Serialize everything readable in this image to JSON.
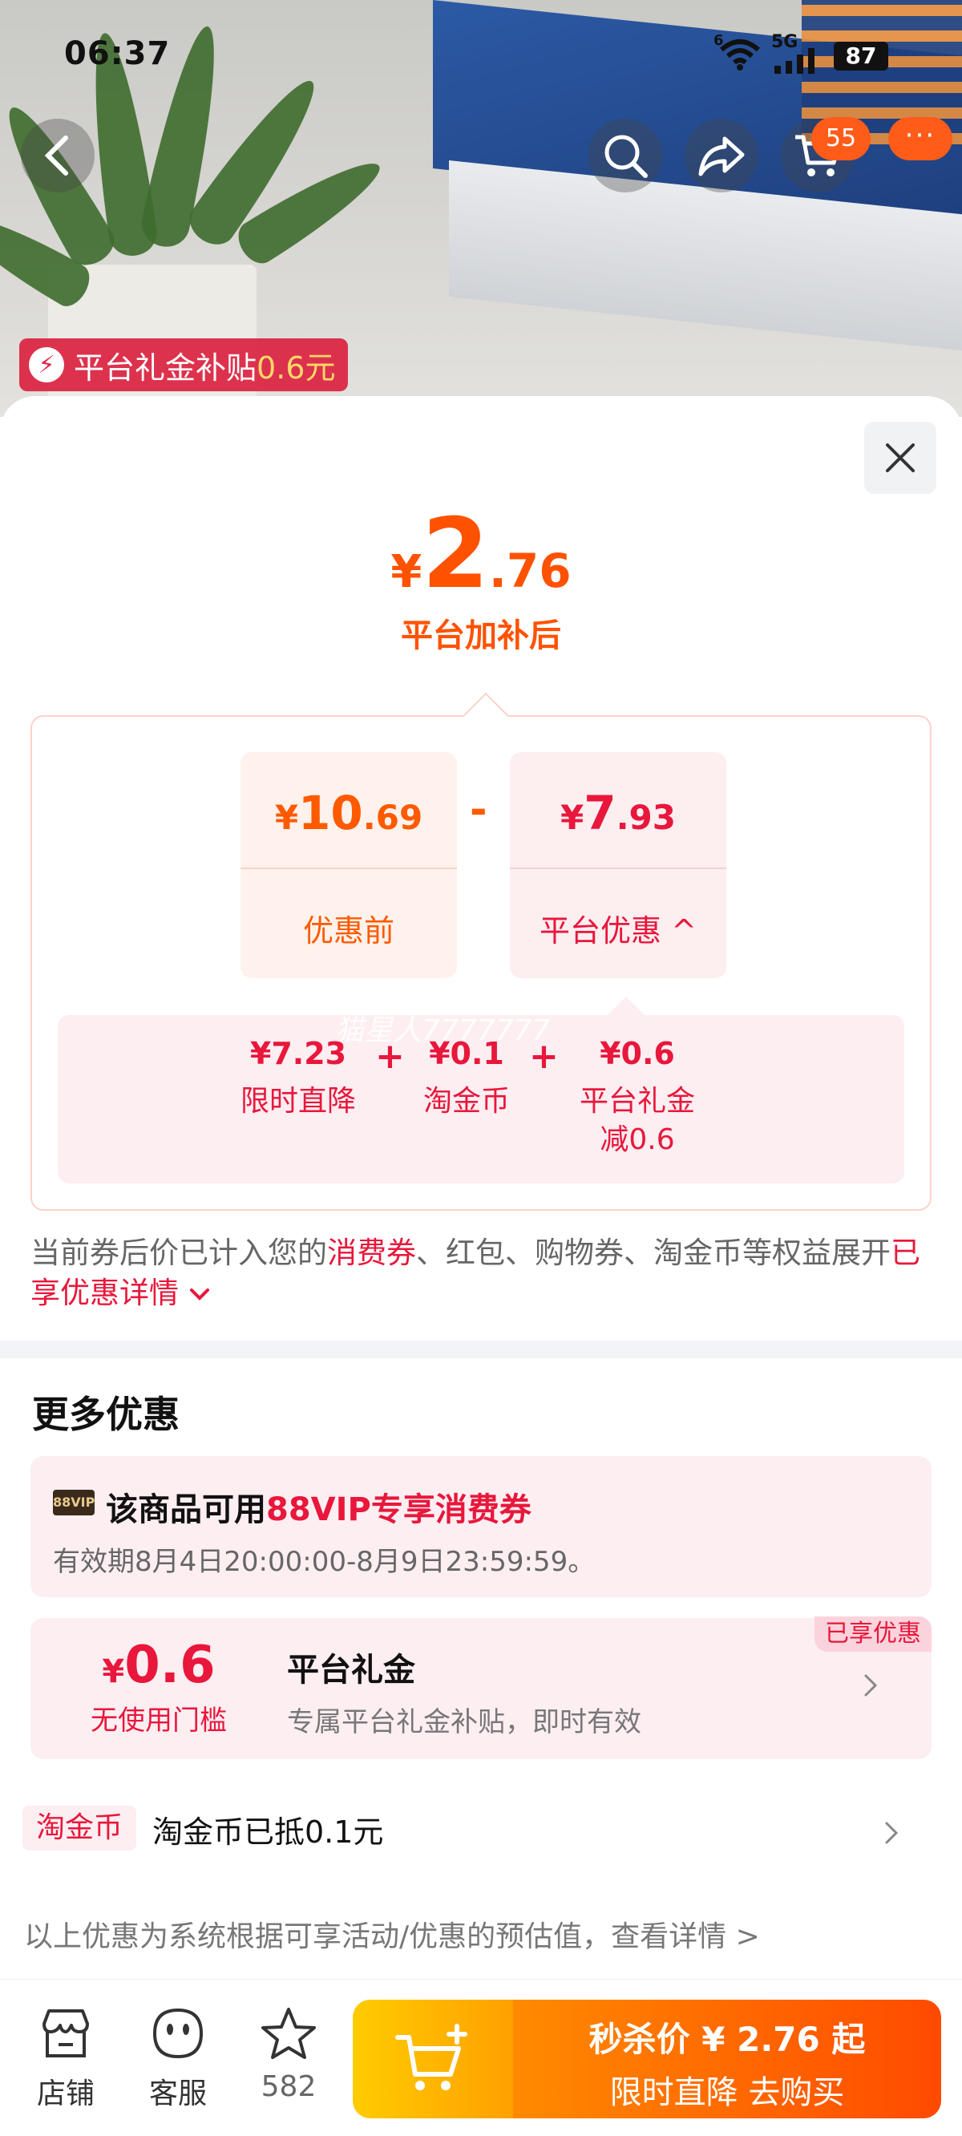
{
  "status_bar": {
    "time": "06:37",
    "wifi_label": "6",
    "network": "5G",
    "battery": "87"
  },
  "nav": {
    "cart_count": "55",
    "more_label": "···"
  },
  "subsidy_tag": {
    "label": "平台礼金补贴",
    "amount": "0.6元"
  },
  "final_price": {
    "currency": "¥",
    "integer": "2",
    "decimal": ".76",
    "caption": "平台加补后"
  },
  "calc": {
    "before": {
      "currency": "¥",
      "integer": "10",
      "decimal": ".69",
      "label": "优惠前"
    },
    "operator": "-",
    "discount": {
      "currency": "¥",
      "integer": "7",
      "decimal": ".93",
      "label": "平台优惠",
      "chevron": "^"
    }
  },
  "breakdown": {
    "items": [
      {
        "value": "¥7.23",
        "label": "限时直降"
      },
      {
        "value": "¥0.1",
        "label": "淘金币"
      },
      {
        "value": "¥0.6",
        "label": "平台礼金",
        "label2": "减0.6"
      }
    ],
    "plus": "+",
    "watermark": "猫星人7777777"
  },
  "note": {
    "prefix": "当前券后价已计入您的",
    "highlight": "消费券",
    "middle": "、红包、购物券、淘金币等权益展开",
    "link": "已享优惠详情"
  },
  "more_offers": {
    "title": "更多优惠",
    "vip": {
      "badge": "88VIP",
      "title_prefix": "该商品可用",
      "title_highlight": "88VIP专享消费券",
      "validity": "有效期8月4日20:00:00-8月9日23:59:59。"
    },
    "gift": {
      "currency": "¥",
      "amount": "0.6",
      "threshold": "无使用门槛",
      "name": "平台礼金",
      "desc": "专属平台礼金补贴，即时有效",
      "tag": "已享优惠"
    },
    "coin": {
      "tag": "淘金币",
      "text": "淘金币已抵0.1元"
    },
    "footnote": "以上优惠为系统根据可享活动/优惠的预估值，查看详情 >"
  },
  "bottom": {
    "tabs": [
      {
        "label": "店铺"
      },
      {
        "label": "客服"
      },
      {
        "label": "582"
      }
    ],
    "buy": {
      "line1": "秒杀价 ¥ 2.76 起",
      "line2": "限时直降  去购买"
    }
  },
  "colors": {
    "accent_orange": "#ff5200",
    "accent_red": "#e8173b"
  }
}
